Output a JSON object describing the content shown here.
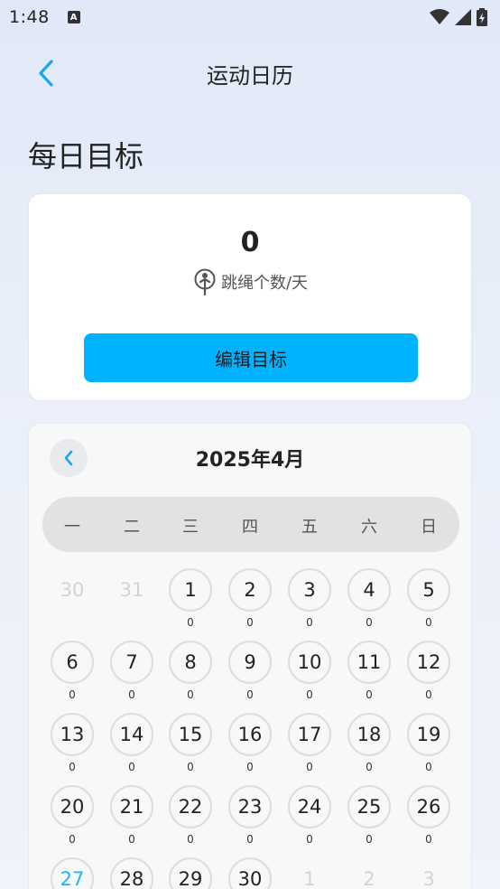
{
  "status_bar": {
    "time": "1:48",
    "notification": "A"
  },
  "header": {
    "title": "运动日历"
  },
  "daily_goal": {
    "section_title": "每日目标",
    "value": "0",
    "unit": "跳绳个数/天",
    "edit_button": "编辑目标"
  },
  "calendar": {
    "month_label": "2025年4月",
    "weekdays": [
      "一",
      "二",
      "三",
      "四",
      "五",
      "六",
      "日"
    ],
    "weeks": [
      [
        {
          "d": "30",
          "c": "",
          "faded": true
        },
        {
          "d": "31",
          "c": "",
          "faded": true
        },
        {
          "d": "1",
          "c": "0"
        },
        {
          "d": "2",
          "c": "0"
        },
        {
          "d": "3",
          "c": "0"
        },
        {
          "d": "4",
          "c": "0"
        },
        {
          "d": "5",
          "c": "0"
        }
      ],
      [
        {
          "d": "6",
          "c": "0"
        },
        {
          "d": "7",
          "c": "0"
        },
        {
          "d": "8",
          "c": "0"
        },
        {
          "d": "9",
          "c": "0"
        },
        {
          "d": "10",
          "c": "0"
        },
        {
          "d": "11",
          "c": "0"
        },
        {
          "d": "12",
          "c": "0"
        }
      ],
      [
        {
          "d": "13",
          "c": "0"
        },
        {
          "d": "14",
          "c": "0"
        },
        {
          "d": "15",
          "c": "0"
        },
        {
          "d": "16",
          "c": "0"
        },
        {
          "d": "17",
          "c": "0"
        },
        {
          "d": "18",
          "c": "0"
        },
        {
          "d": "19",
          "c": "0"
        }
      ],
      [
        {
          "d": "20",
          "c": "0"
        },
        {
          "d": "21",
          "c": "0"
        },
        {
          "d": "22",
          "c": "0"
        },
        {
          "d": "23",
          "c": "0"
        },
        {
          "d": "24",
          "c": "0"
        },
        {
          "d": "25",
          "c": "0"
        },
        {
          "d": "26",
          "c": "0"
        }
      ],
      [
        {
          "d": "27",
          "c": "",
          "today": true
        },
        {
          "d": "28",
          "c": ""
        },
        {
          "d": "29",
          "c": ""
        },
        {
          "d": "30",
          "c": ""
        },
        {
          "d": "1",
          "c": "",
          "faded": true
        },
        {
          "d": "2",
          "c": "",
          "faded": true
        },
        {
          "d": "3",
          "c": "",
          "faded": true
        }
      ]
    ]
  },
  "icons": {
    "back": "chevron-left-icon",
    "prev_month": "chevron-left-icon",
    "goal": "jump-rope-person-icon"
  },
  "colors": {
    "accent": "#00b3ff",
    "today": "#1ab3ff"
  }
}
